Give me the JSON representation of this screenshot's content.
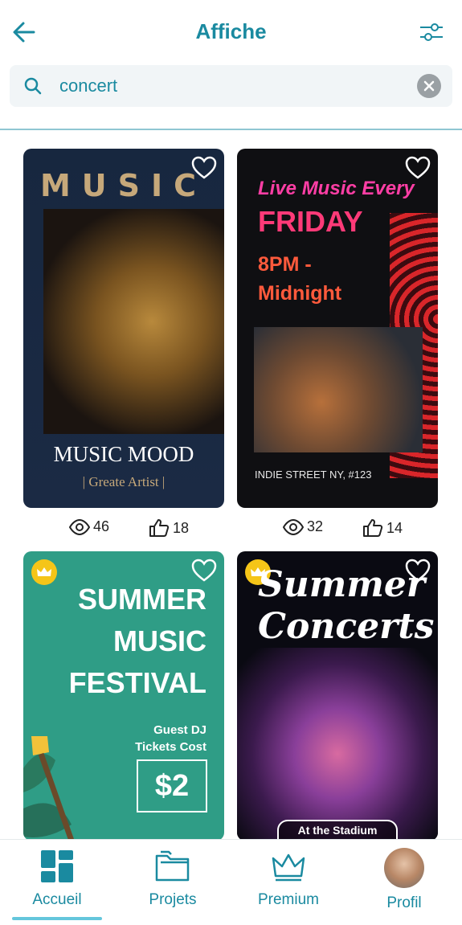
{
  "header": {
    "title": "Affiche"
  },
  "search": {
    "value": "concert"
  },
  "cards": [
    {
      "title": "MUSIC",
      "main": "MUSIC MOOD",
      "sub": "|  Greate Artist  |",
      "views": "46",
      "likes": "18"
    },
    {
      "line1": "Live Music Every",
      "line2": "FRIDAY",
      "line3": "8PM - Midnight",
      "bottom": "INDIE STREET NY, #123",
      "views": "32",
      "likes": "14"
    },
    {
      "text": "SUMMER MUSIC FESTIVAL",
      "guest": "Guest DJ Tickets Cost",
      "price": "$2"
    },
    {
      "title": "Summer Concerts",
      "badge": "At the Stadium"
    }
  ],
  "nav": {
    "items": [
      {
        "label": "Accueil"
      },
      {
        "label": "Projets"
      },
      {
        "label": "Premium"
      },
      {
        "label": "Profil"
      }
    ]
  },
  "colors": {
    "accent": "#1a8aa0",
    "active_bar": "#64c6dc",
    "crown": "#f5c518"
  }
}
